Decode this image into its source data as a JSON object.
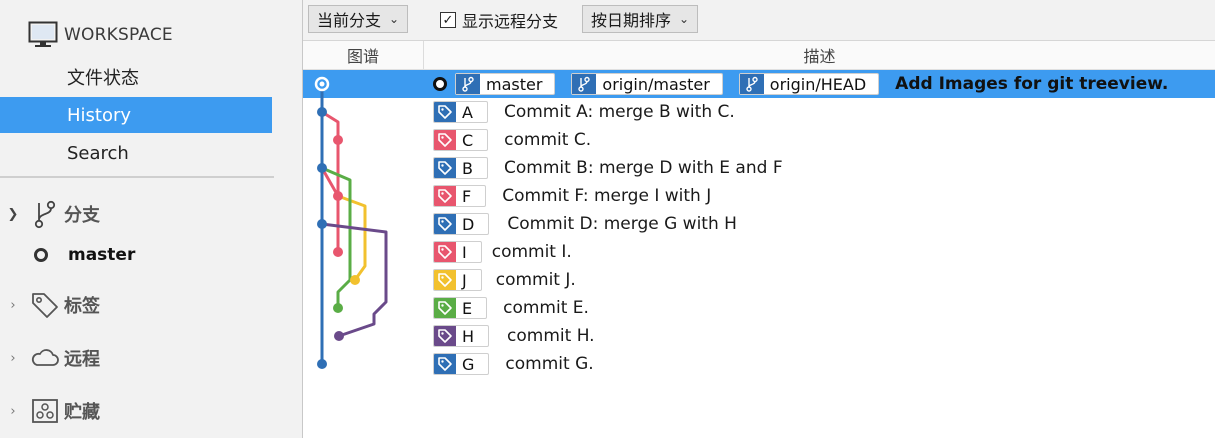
{
  "sidebar": {
    "workspace_label": "WORKSPACE",
    "nav": [
      {
        "label": "文件状态",
        "active": false
      },
      {
        "label": "History",
        "active": true
      },
      {
        "label": "Search",
        "active": false
      }
    ],
    "sections": {
      "branches": {
        "label": "分支",
        "expanded": true,
        "items": [
          {
            "label": "master"
          }
        ]
      },
      "tags": {
        "label": "标签",
        "expanded": false
      },
      "remotes": {
        "label": "远程",
        "expanded": false
      },
      "stashes": {
        "label": "贮藏",
        "expanded": false
      }
    }
  },
  "toolbar": {
    "branch_filter": "当前分支",
    "show_remote_label": "显示远程分支",
    "show_remote_checked": true,
    "sort_order": "按日期排序"
  },
  "columns": {
    "graph": "图谱",
    "description": "描述"
  },
  "colors": {
    "accent": "#3d9bf0",
    "blue": "#2f6fb5",
    "red": "#e8566e",
    "green": "#5aad46",
    "yellow": "#f2c12e",
    "purple": "#6a4a8a"
  },
  "commits": [
    {
      "branches": [
        "master",
        "origin/master",
        "origin/HEAD"
      ],
      "message": "Add Images for git treeview.",
      "selected": true
    },
    {
      "tag": "A",
      "tag_color": "blue",
      "message": "Commit A: merge B with C."
    },
    {
      "tag": "C",
      "tag_color": "red",
      "message": "commit C."
    },
    {
      "tag": "B",
      "tag_color": "blue",
      "message": "Commit B: merge D with E and F"
    },
    {
      "tag": "F",
      "tag_color": "red",
      "message": "Commit F: merge I with J"
    },
    {
      "tag": "D",
      "tag_color": "blue",
      "message": "Commit D: merge G with H"
    },
    {
      "tag": "I",
      "tag_color": "red",
      "message": "commit I."
    },
    {
      "tag": "J",
      "tag_color": "yellow",
      "message": "commit J."
    },
    {
      "tag": "E",
      "tag_color": "green",
      "message": "commit E."
    },
    {
      "tag": "H",
      "tag_color": "purple",
      "message": "commit H."
    },
    {
      "tag": "G",
      "tag_color": "blue",
      "message": "commit G."
    }
  ]
}
